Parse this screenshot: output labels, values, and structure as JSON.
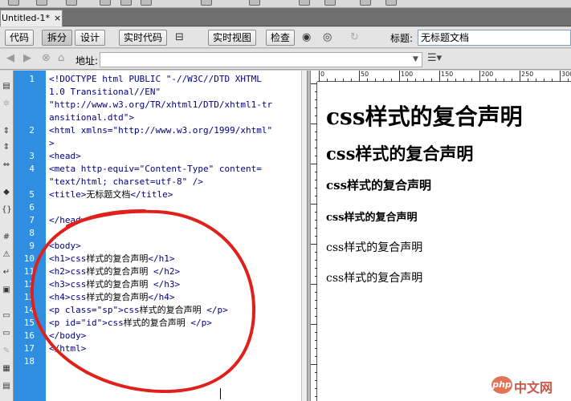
{
  "tab": {
    "title": "Untitled-1*",
    "close": "×"
  },
  "toolbar": {
    "code": "代码",
    "split": "拆分",
    "design": "设计",
    "live_code": "实时代码",
    "live_view": "实时视图",
    "inspect": "检查",
    "title_label": "标题:",
    "title_value": "无标题文档"
  },
  "address": {
    "label": "地址:",
    "value": ""
  },
  "code_lines": [
    {
      "num": "1",
      "parts": [
        {
          "t": "<!DOCTYPE html PUBLIC \"-//W3C//DTD XHTML"
        }
      ]
    },
    {
      "num": "",
      "parts": [
        {
          "t": "1.0 Transitional//EN\""
        }
      ]
    },
    {
      "num": "",
      "parts": [
        {
          "t": "\"http://www.w3.org/TR/xhtml1/DTD/xhtml1-tr"
        }
      ]
    },
    {
      "num": "",
      "parts": [
        {
          "t": "ansitional.dtd\">"
        }
      ]
    },
    {
      "num": "2",
      "parts": [
        {
          "t": "<html xmlns=\"http://www.w3.org/1999/xhtml\""
        }
      ]
    },
    {
      "num": "",
      "parts": [
        {
          "t": ">"
        }
      ]
    },
    {
      "num": "3",
      "parts": [
        {
          "t": "<head>"
        }
      ]
    },
    {
      "num": "4",
      "parts": [
        {
          "t": "<meta http-equiv=\"Content-Type\" content="
        }
      ]
    },
    {
      "num": "",
      "parts": [
        {
          "t": "\"text/html; charset=utf-8\" />"
        }
      ]
    },
    {
      "num": "5",
      "parts": [
        {
          "t": "<title>"
        },
        {
          "t": "无标题文档",
          "cjk": true
        },
        {
          "t": "</title>"
        }
      ]
    },
    {
      "num": "6",
      "parts": [
        {
          "t": ""
        }
      ]
    },
    {
      "num": "7",
      "parts": [
        {
          "t": "</head>"
        }
      ]
    },
    {
      "num": "8",
      "parts": [
        {
          "t": ""
        }
      ]
    },
    {
      "num": "9",
      "parts": [
        {
          "t": "<body>"
        }
      ]
    },
    {
      "num": "10",
      "parts": [
        {
          "t": "<h1>css"
        },
        {
          "t": "样式的复合声明",
          "cjk": true
        },
        {
          "t": "</h1>"
        }
      ]
    },
    {
      "num": "11",
      "parts": [
        {
          "t": "<h2>css"
        },
        {
          "t": "样式的复合声明",
          "cjk": true
        },
        {
          "t": " </h2>"
        }
      ]
    },
    {
      "num": "12",
      "parts": [
        {
          "t": "<h3>css"
        },
        {
          "t": "样式的复合声明",
          "cjk": true
        },
        {
          "t": " </h3>"
        }
      ]
    },
    {
      "num": "13",
      "parts": [
        {
          "t": "<h4>css"
        },
        {
          "t": "样式的复合声明",
          "cjk": true
        },
        {
          "t": "</h4>"
        }
      ]
    },
    {
      "num": "14",
      "parts": [
        {
          "t": "<p class=\"sp\">css"
        },
        {
          "t": "样式的复合声明",
          "cjk": true
        },
        {
          "t": " </p>"
        }
      ]
    },
    {
      "num": "15",
      "parts": [
        {
          "t": "<p id=\"id\">css"
        },
        {
          "t": "样式的复合声明",
          "cjk": true
        },
        {
          "t": " </p>"
        }
      ]
    },
    {
      "num": "16",
      "parts": [
        {
          "t": "</body>"
        }
      ]
    },
    {
      "num": "17",
      "parts": [
        {
          "t": "</html>"
        }
      ]
    },
    {
      "num": "18",
      "parts": [
        {
          "t": ""
        }
      ]
    }
  ],
  "ruler": {
    "labels": [
      "0",
      "50",
      "100",
      "150",
      "200",
      "250",
      "300"
    ]
  },
  "design_view": {
    "h1": "css样式的复合声明",
    "h2": "css样式的复合声明",
    "h3": "css样式的复合声明",
    "h4": "css样式的复合声明",
    "p1": "css样式的复合声明",
    "p2": "css样式的复合声明"
  },
  "watermark": {
    "logo": "php",
    "text": "中文网"
  },
  "colors": {
    "gutter": "#2f8ee0",
    "annotation": "#e0201b",
    "code_text": "#000080"
  }
}
